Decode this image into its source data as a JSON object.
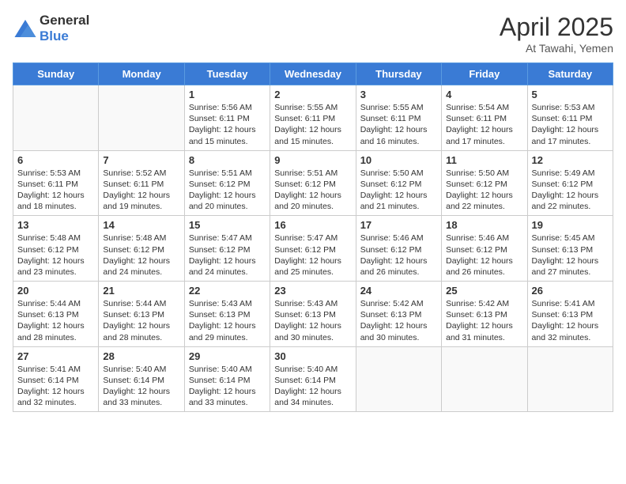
{
  "header": {
    "logo_general": "General",
    "logo_blue": "Blue",
    "month_year": "April 2025",
    "location": "At Tawahi, Yemen"
  },
  "days_of_week": [
    "Sunday",
    "Monday",
    "Tuesday",
    "Wednesday",
    "Thursday",
    "Friday",
    "Saturday"
  ],
  "weeks": [
    [
      {
        "day": "",
        "info": ""
      },
      {
        "day": "",
        "info": ""
      },
      {
        "day": "1",
        "info": "Sunrise: 5:56 AM\nSunset: 6:11 PM\nDaylight: 12 hours and 15 minutes."
      },
      {
        "day": "2",
        "info": "Sunrise: 5:55 AM\nSunset: 6:11 PM\nDaylight: 12 hours and 15 minutes."
      },
      {
        "day": "3",
        "info": "Sunrise: 5:55 AM\nSunset: 6:11 PM\nDaylight: 12 hours and 16 minutes."
      },
      {
        "day": "4",
        "info": "Sunrise: 5:54 AM\nSunset: 6:11 PM\nDaylight: 12 hours and 17 minutes."
      },
      {
        "day": "5",
        "info": "Sunrise: 5:53 AM\nSunset: 6:11 PM\nDaylight: 12 hours and 17 minutes."
      }
    ],
    [
      {
        "day": "6",
        "info": "Sunrise: 5:53 AM\nSunset: 6:11 PM\nDaylight: 12 hours and 18 minutes."
      },
      {
        "day": "7",
        "info": "Sunrise: 5:52 AM\nSunset: 6:11 PM\nDaylight: 12 hours and 19 minutes."
      },
      {
        "day": "8",
        "info": "Sunrise: 5:51 AM\nSunset: 6:12 PM\nDaylight: 12 hours and 20 minutes."
      },
      {
        "day": "9",
        "info": "Sunrise: 5:51 AM\nSunset: 6:12 PM\nDaylight: 12 hours and 20 minutes."
      },
      {
        "day": "10",
        "info": "Sunrise: 5:50 AM\nSunset: 6:12 PM\nDaylight: 12 hours and 21 minutes."
      },
      {
        "day": "11",
        "info": "Sunrise: 5:50 AM\nSunset: 6:12 PM\nDaylight: 12 hours and 22 minutes."
      },
      {
        "day": "12",
        "info": "Sunrise: 5:49 AM\nSunset: 6:12 PM\nDaylight: 12 hours and 22 minutes."
      }
    ],
    [
      {
        "day": "13",
        "info": "Sunrise: 5:48 AM\nSunset: 6:12 PM\nDaylight: 12 hours and 23 minutes."
      },
      {
        "day": "14",
        "info": "Sunrise: 5:48 AM\nSunset: 6:12 PM\nDaylight: 12 hours and 24 minutes."
      },
      {
        "day": "15",
        "info": "Sunrise: 5:47 AM\nSunset: 6:12 PM\nDaylight: 12 hours and 24 minutes."
      },
      {
        "day": "16",
        "info": "Sunrise: 5:47 AM\nSunset: 6:12 PM\nDaylight: 12 hours and 25 minutes."
      },
      {
        "day": "17",
        "info": "Sunrise: 5:46 AM\nSunset: 6:12 PM\nDaylight: 12 hours and 26 minutes."
      },
      {
        "day": "18",
        "info": "Sunrise: 5:46 AM\nSunset: 6:12 PM\nDaylight: 12 hours and 26 minutes."
      },
      {
        "day": "19",
        "info": "Sunrise: 5:45 AM\nSunset: 6:13 PM\nDaylight: 12 hours and 27 minutes."
      }
    ],
    [
      {
        "day": "20",
        "info": "Sunrise: 5:44 AM\nSunset: 6:13 PM\nDaylight: 12 hours and 28 minutes."
      },
      {
        "day": "21",
        "info": "Sunrise: 5:44 AM\nSunset: 6:13 PM\nDaylight: 12 hours and 28 minutes."
      },
      {
        "day": "22",
        "info": "Sunrise: 5:43 AM\nSunset: 6:13 PM\nDaylight: 12 hours and 29 minutes."
      },
      {
        "day": "23",
        "info": "Sunrise: 5:43 AM\nSunset: 6:13 PM\nDaylight: 12 hours and 30 minutes."
      },
      {
        "day": "24",
        "info": "Sunrise: 5:42 AM\nSunset: 6:13 PM\nDaylight: 12 hours and 30 minutes."
      },
      {
        "day": "25",
        "info": "Sunrise: 5:42 AM\nSunset: 6:13 PM\nDaylight: 12 hours and 31 minutes."
      },
      {
        "day": "26",
        "info": "Sunrise: 5:41 AM\nSunset: 6:13 PM\nDaylight: 12 hours and 32 minutes."
      }
    ],
    [
      {
        "day": "27",
        "info": "Sunrise: 5:41 AM\nSunset: 6:14 PM\nDaylight: 12 hours and 32 minutes."
      },
      {
        "day": "28",
        "info": "Sunrise: 5:40 AM\nSunset: 6:14 PM\nDaylight: 12 hours and 33 minutes."
      },
      {
        "day": "29",
        "info": "Sunrise: 5:40 AM\nSunset: 6:14 PM\nDaylight: 12 hours and 33 minutes."
      },
      {
        "day": "30",
        "info": "Sunrise: 5:40 AM\nSunset: 6:14 PM\nDaylight: 12 hours and 34 minutes."
      },
      {
        "day": "",
        "info": ""
      },
      {
        "day": "",
        "info": ""
      },
      {
        "day": "",
        "info": ""
      }
    ]
  ]
}
